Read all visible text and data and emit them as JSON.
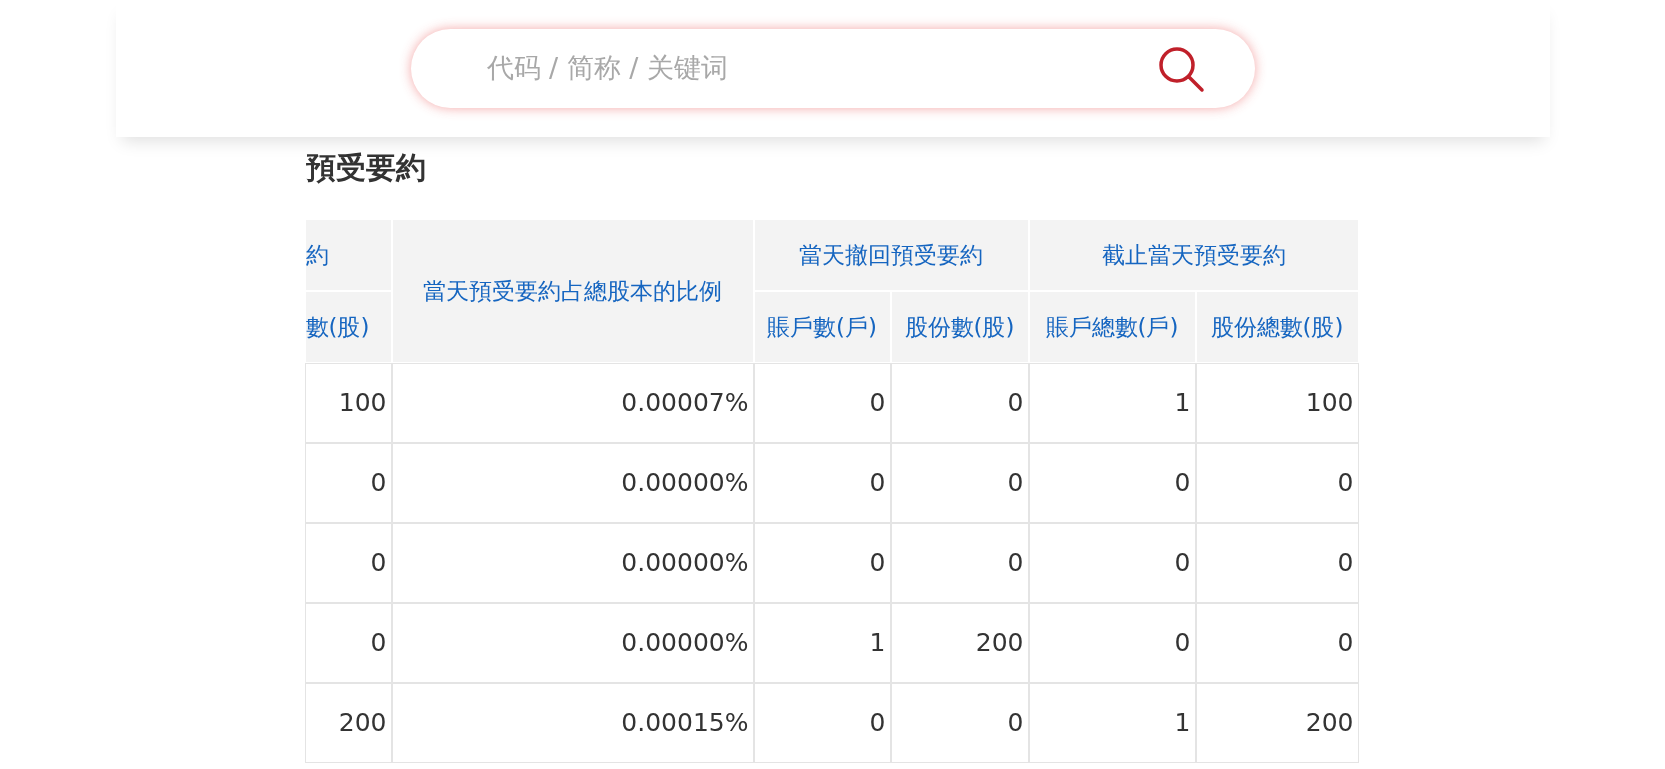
{
  "search": {
    "placeholder": "代码 / 简称 / 关键词"
  },
  "section_title": "預受要約",
  "table": {
    "header_top": [
      {
        "label": "約",
        "kind": "cut"
      },
      {
        "label": "當天預受要約占總股本的比例",
        "kind": "single"
      },
      {
        "label": "當天撤回預受要約",
        "kind": "group"
      },
      {
        "label": "截止當天預受要約",
        "kind": "group"
      }
    ],
    "header_sub": [
      "數(股)",
      "賬戶數(戶)",
      "股份數(股)",
      "賬戶總數(戶)",
      "股份總數(股)"
    ],
    "rows": [
      [
        "100",
        "0.00007%",
        "0",
        "0",
        "1",
        "100"
      ],
      [
        "0",
        "0.00000%",
        "0",
        "0",
        "0",
        "0"
      ],
      [
        "0",
        "0.00000%",
        "0",
        "0",
        "0",
        "0"
      ],
      [
        "0",
        "0.00000%",
        "1",
        "200",
        "0",
        "0"
      ],
      [
        "200",
        "0.00015%",
        "0",
        "0",
        "1",
        "200"
      ]
    ]
  }
}
